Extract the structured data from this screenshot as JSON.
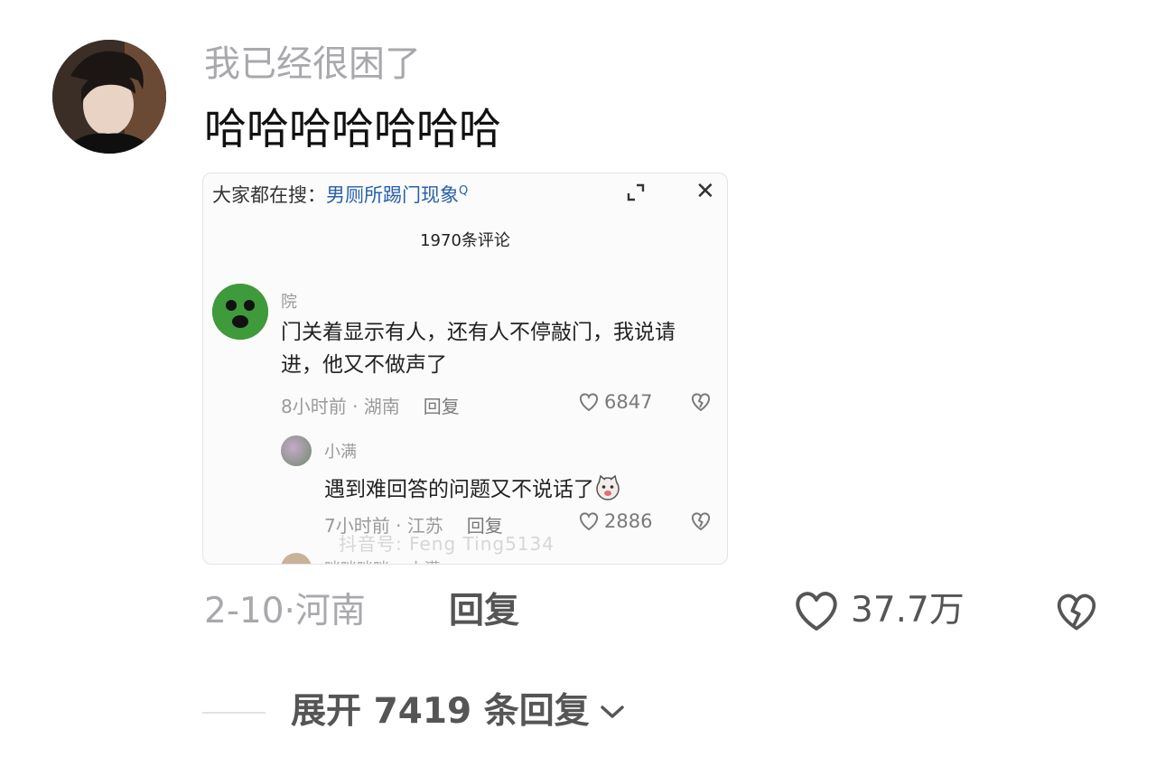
{
  "comment": {
    "username": "我已经很困了",
    "text": "哈哈哈哈哈哈哈",
    "date_location": "2-10·河南",
    "reply_label": "回复",
    "like_count": "37.7万",
    "expand_replies": "展开 7419 条回复"
  },
  "embedded_screenshot": {
    "search_prefix": "大家都在搜：",
    "search_keyword": "男厕所踢门现象",
    "comment_count": "1970条评论",
    "comments": [
      {
        "name": "院",
        "text": "门关着显示有人，还有人不停敲门，我说请进，他又不做声了",
        "meta": "8小时前 · 湖南",
        "reply": "回复",
        "likes": "6847"
      },
      {
        "name": "小满",
        "text": "遇到难回答的问题又不说话了",
        "meta": "7小时前 · 江苏",
        "reply": "回复",
        "likes": "2886"
      }
    ],
    "watermark": "抖音号: Feng Ting5134",
    "partial_name": "咪咪咪咪 ▸ 小满"
  },
  "colors": {
    "muted": "#a8a8ad",
    "keyword": "#2760a8",
    "avatar_green": "#3e9a3a"
  }
}
